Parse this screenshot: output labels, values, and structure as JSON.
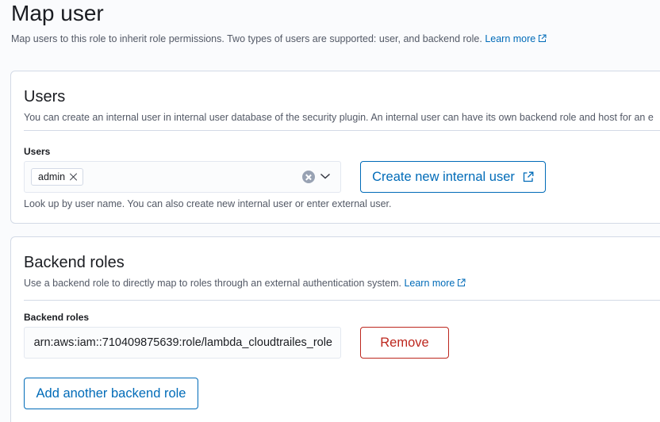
{
  "header": {
    "title": "Map user",
    "description": "Map users to this role to inherit role permissions. Two types of users are supported: user, and backend role.",
    "learn_more": "Learn more"
  },
  "users_panel": {
    "title": "Users",
    "description": "You can create an internal user in internal user database of the security plugin. An internal user can have its own backend role and host for an e",
    "field_label": "Users",
    "selected_users": [
      "admin"
    ],
    "help_text": "Look up by user name. You can also create new internal user or enter external user.",
    "create_button": "Create new internal user"
  },
  "backend_panel": {
    "title": "Backend roles",
    "description": "Use a backend role to directly map to roles through an external authentication system.",
    "learn_more": "Learn more",
    "field_label": "Backend roles",
    "role_value": "arn:aws:iam::710409875639:role/lambda_cloudtrailes_role",
    "remove_button": "Remove",
    "add_button": "Add another backend role"
  },
  "colors": {
    "link": "#006bb8",
    "danger": "#bd271e",
    "border": "#d3dae6",
    "subdued_text": "#535966"
  },
  "icons": {
    "external_link": "external-link-icon",
    "clear": "clear-icon",
    "chevron": "chevron-down-icon",
    "pill_remove": "close-icon"
  }
}
